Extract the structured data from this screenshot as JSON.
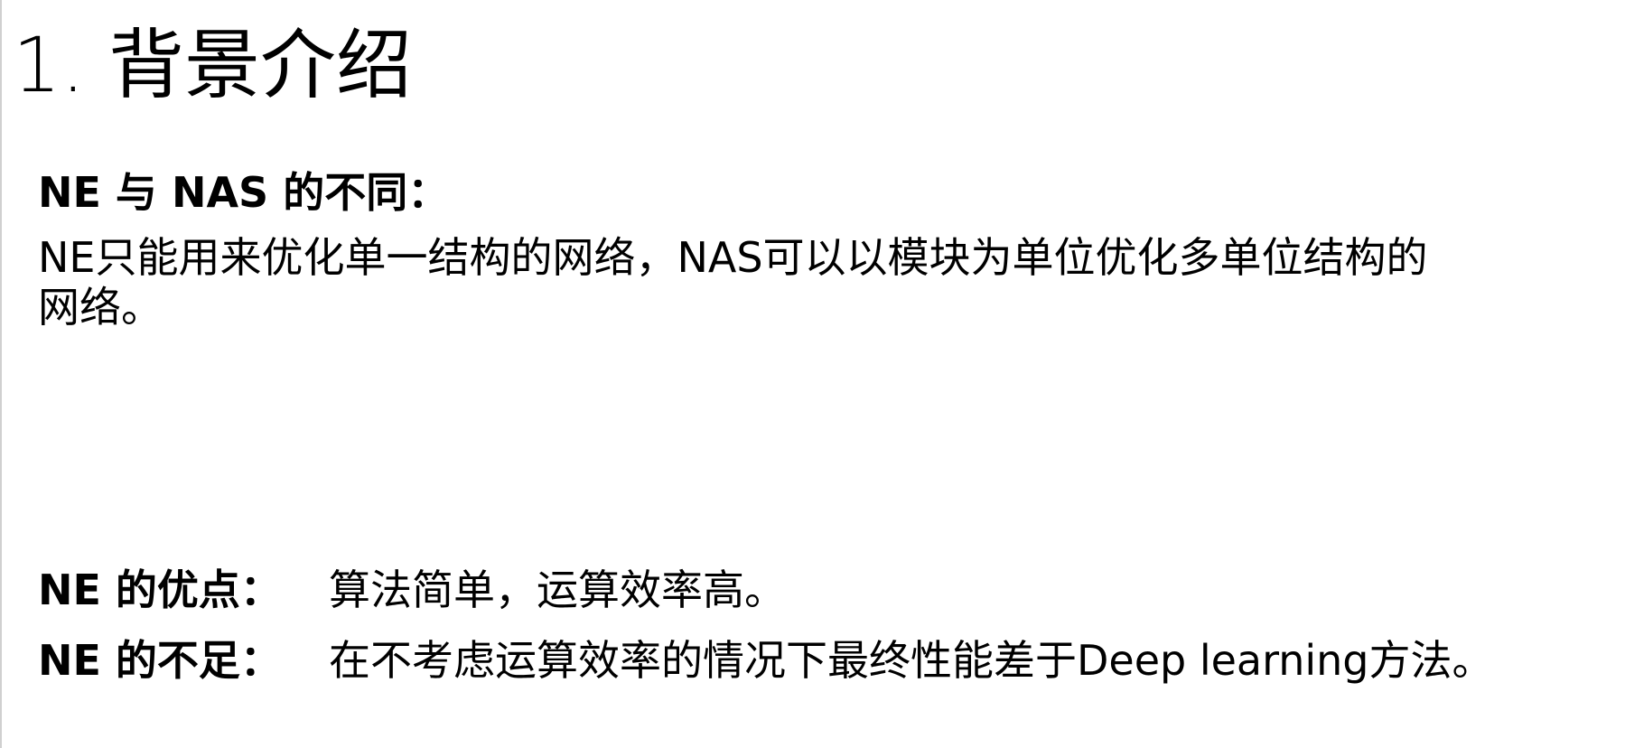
{
  "slide": {
    "number": "1.",
    "title": "背景介绍"
  },
  "comparison": {
    "heading": "NE  与  NAS 的不同：",
    "line1": "NE只能用来优化单一结构的网络，NAS可以以模块为单位优化多单位结构的",
    "line2": "网络。"
  },
  "pros": {
    "label": "NE 的优点：",
    "text": "算法简单，运算效率高。"
  },
  "cons": {
    "label": "NE 的不足：",
    "text": "在不考虑运算效率的情况下最终性能差于Deep learning方法。"
  }
}
